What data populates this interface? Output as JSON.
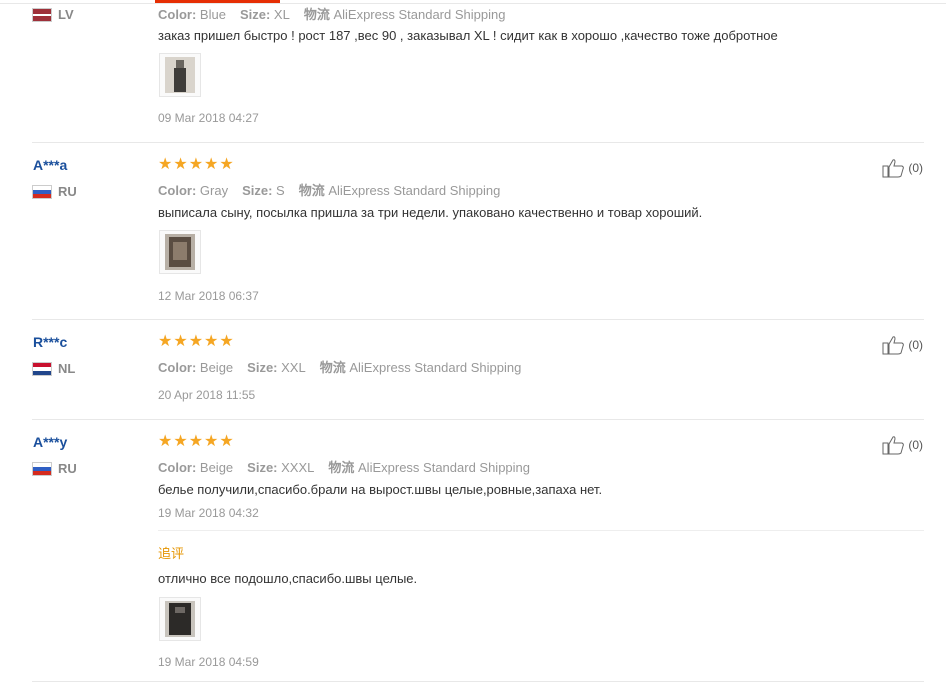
{
  "top_review": {
    "country": "LV",
    "color_label": "Color:",
    "color": "Blue",
    "size_label": "Size:",
    "size": "XL",
    "shipping_label": "物流",
    "shipping": "AliExpress Standard Shipping",
    "text": "заказ пришел быстро ! рост 187 ,вес 90 , заказывал XL ! сидит как в хорошо ,качество тоже добротное",
    "date": "09 Mar 2018 04:27"
  },
  "reviews": [
    {
      "user": "A***a",
      "country": "RU",
      "color_label": "Color:",
      "color": "Gray",
      "size_label": "Size:",
      "size": "S",
      "shipping_label": "物流",
      "shipping": "AliExpress Standard Shipping",
      "text": "выписала сыну, посылка пришла за три недели. упаковано качественно и товар хороший.",
      "date": "12 Mar 2018 06:37",
      "likes": "(0)"
    },
    {
      "user": "R***c",
      "country": "NL",
      "color_label": "Color:",
      "color": "Beige",
      "size_label": "Size:",
      "size": "XXL",
      "shipping_label": "物流",
      "shipping": "AliExpress Standard Shipping",
      "date": "20 Apr 2018 11:55",
      "likes": "(0)"
    },
    {
      "user": "A***y",
      "country": "RU",
      "color_label": "Color:",
      "color": "Beige",
      "size_label": "Size:",
      "size": "XXXL",
      "shipping_label": "物流",
      "shipping": "AliExpress Standard Shipping",
      "text": "белье получили,спасибо.брали на вырост.швы целые,ровные,запаха нет.",
      "date": "19 Mar 2018 04:32",
      "likes": "(0)",
      "additional_label": "追评",
      "additional_text": "отлично все подошло,спасибо.швы целые.",
      "additional_date": "19 Mar 2018 04:59"
    }
  ],
  "star_glyph": "★",
  "rating": 5,
  "colors": {
    "star": "#f5a623",
    "username": "#1a4f9c",
    "additional_label": "#e59400",
    "accent": "#e62e04"
  }
}
